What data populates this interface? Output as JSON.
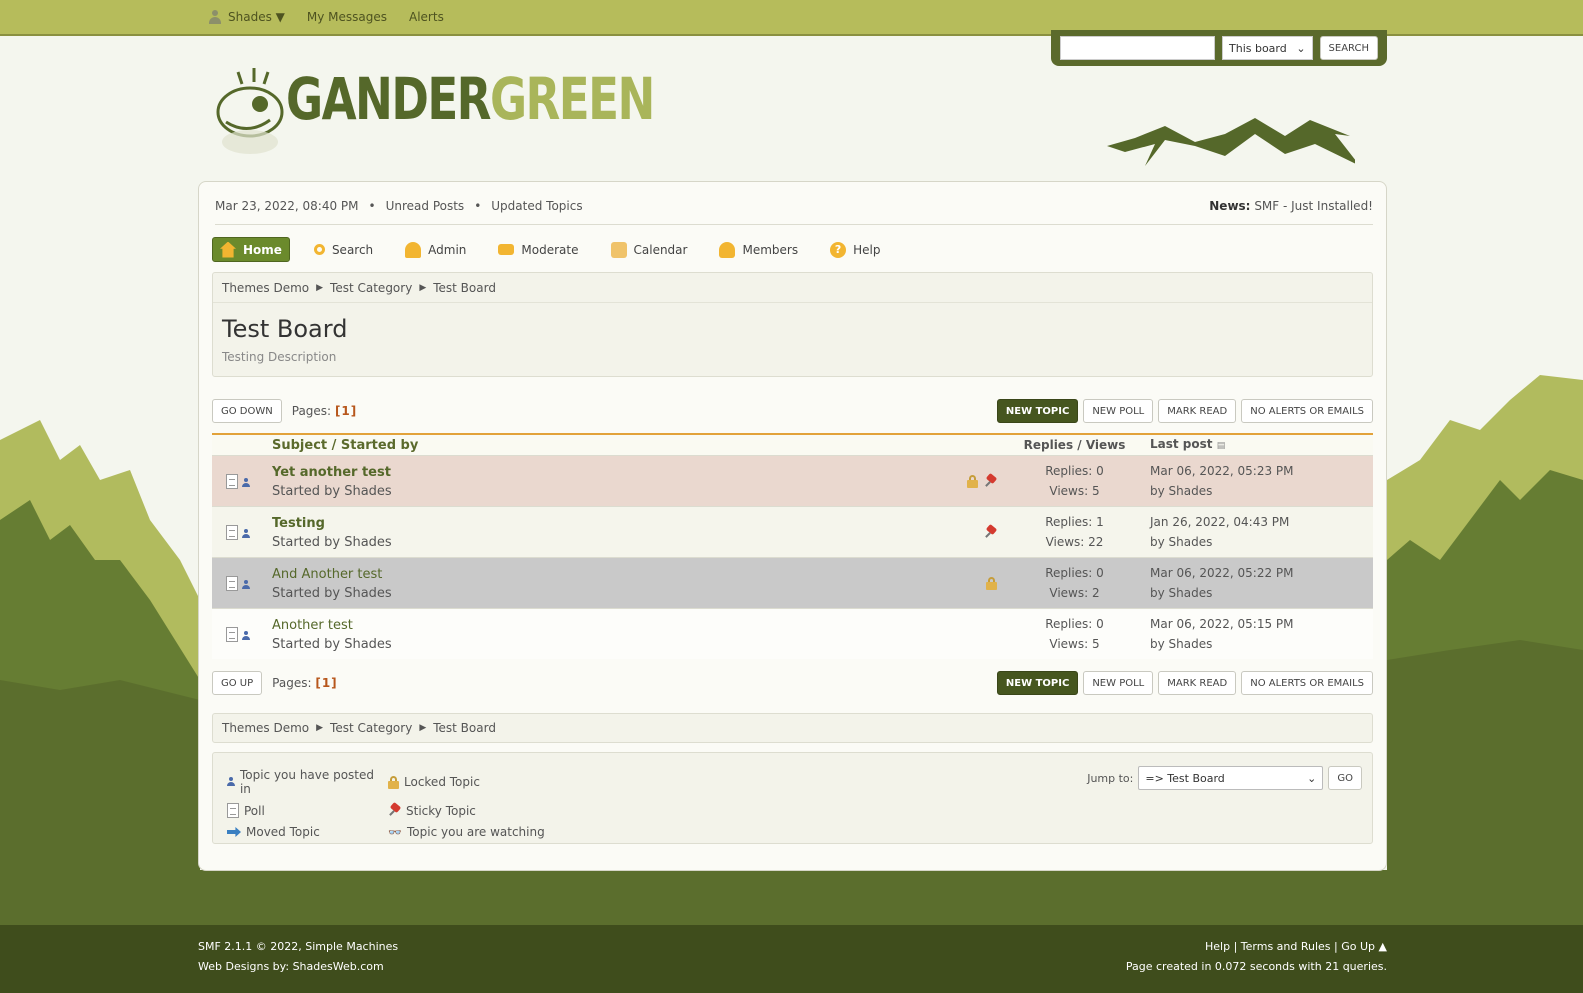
{
  "topbar": {
    "user_label": "Shades ▼",
    "messages_label": "My Messages",
    "alerts_label": "Alerts"
  },
  "search": {
    "placeholder": "",
    "scope_value": "This board",
    "button_label": "SEARCH"
  },
  "logo": {
    "word1": "GANDER",
    "word2": "GREEN"
  },
  "info": {
    "datetime": "Mar 23, 2022, 08:40 PM",
    "unread_label": "Unread Posts",
    "updated_label": "Updated Topics",
    "news_label": "News:",
    "news_text": "SMF - Just Installed!"
  },
  "menu": {
    "home": "Home",
    "search": "Search",
    "admin": "Admin",
    "moderate": "Moderate",
    "calendar": "Calendar",
    "members": "Members",
    "help": "Help"
  },
  "breadcrumb": [
    "Themes Demo",
    "Test Category",
    "Test Board"
  ],
  "board": {
    "title": "Test Board",
    "description": "Testing Description"
  },
  "pagination": {
    "go_down": "GO DOWN",
    "go_up": "GO UP",
    "pages_label": "Pages:",
    "pages_value": "[1]"
  },
  "actions": {
    "new_topic": "NEW TOPIC",
    "new_poll": "NEW POLL",
    "mark_read": "MARK READ",
    "notify": "NO ALERTS OR EMAILS"
  },
  "table": {
    "subject_header": "Subject / Started by",
    "stats_header": "Replies / Views",
    "last_header": "Last post",
    "rows": [
      {
        "subject": "Yet another test",
        "starter": "Started by Shades",
        "replies": "Replies: 0",
        "views": "Views: 5",
        "last_date": "Mar 06, 2022, 05:23 PM",
        "last_by": "by Shades"
      },
      {
        "subject": "Testing",
        "starter": "Started by Shades",
        "replies": "Replies: 1",
        "views": "Views: 22",
        "last_date": "Jan 26, 2022, 04:43 PM",
        "last_by": "by Shades"
      },
      {
        "subject": "And Another test",
        "starter": "Started by Shades",
        "replies": "Replies: 0",
        "views": "Views: 2",
        "last_date": "Mar 06, 2022, 05:22 PM",
        "last_by": "by Shades"
      },
      {
        "subject": "Another test",
        "starter": "Started by Shades",
        "replies": "Replies: 0",
        "views": "Views: 5",
        "last_date": "Mar 06, 2022, 05:15 PM",
        "last_by": "by Shades"
      }
    ]
  },
  "legend": {
    "posted": "Topic you have posted in",
    "locked": "Locked Topic",
    "poll": "Poll",
    "sticky": "Sticky Topic",
    "moved": "Moved Topic",
    "watching": "Topic you are watching"
  },
  "jump": {
    "label": "Jump to:",
    "value": "=> Test Board",
    "go": "GO"
  },
  "footer": {
    "copyright": "SMF 2.1.1 © 2022, Simple Machines",
    "designs": "Web Designs by: ShadesWeb.com",
    "help": "Help",
    "terms": "Terms and Rules",
    "goup": "Go Up ▲",
    "stats": "Page created in 0.072 seconds with 21 queries."
  },
  "colors": {
    "topbar": "#b6bc5b",
    "accent": "#46561f",
    "footer": "#3f4d1c",
    "sticky_row": "#ead8cf",
    "locked_row": "#c9c9c9"
  }
}
